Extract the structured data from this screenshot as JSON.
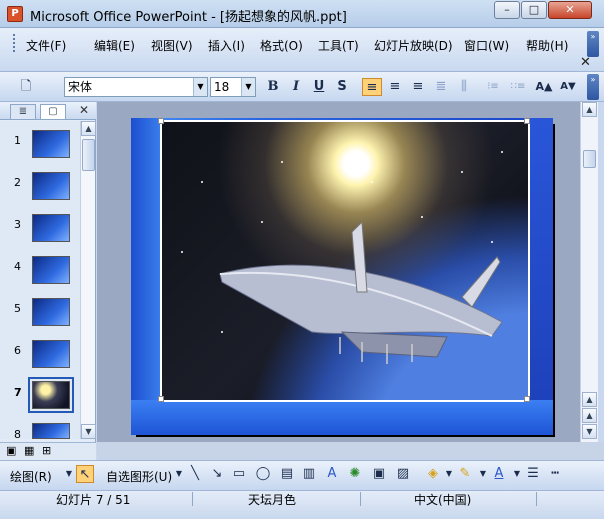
{
  "window": {
    "title": "Microsoft Office PowerPoint - [扬起想象的风帆.ppt]",
    "app_icon": "P",
    "min": "–",
    "max": "□",
    "close": "✕"
  },
  "menu": {
    "items": [
      "文件(F)",
      "编辑(E)",
      "视图(V)",
      "插入(I)",
      "格式(O)",
      "工具(T)",
      "幻灯片放映(D)",
      "窗口(W)",
      "帮助(H)"
    ],
    "close": "✕",
    "chevron": "»"
  },
  "toolbar": {
    "font_name": "宋体",
    "font_size": "18",
    "new_icon": "🗋",
    "bold": "B",
    "italic": "I",
    "underline": "U",
    "shadow": "S",
    "align_left": "≡",
    "align_center": "≡",
    "align_right": "≡",
    "justify": "≣",
    "columns": "⫼",
    "list_numbered": "⁝≡",
    "list_bullets": "∷≡",
    "grow_font": "A▲",
    "shrink_font": "A▼",
    "chevron": "»"
  },
  "panel": {
    "tab_outline": "≣",
    "tab_slides": "▢",
    "close": "✕",
    "slides": [
      {
        "num": "1",
        "style": "blue"
      },
      {
        "num": "2",
        "style": "blue"
      },
      {
        "num": "3",
        "style": "blue"
      },
      {
        "num": "4",
        "style": "blue"
      },
      {
        "num": "5",
        "style": "blue"
      },
      {
        "num": "6",
        "style": "blue"
      },
      {
        "num": "7",
        "style": "dark"
      },
      {
        "num": "8",
        "style": "blue"
      }
    ],
    "selected_slide": "7"
  },
  "drawing": {
    "draw_label": "绘图(R)",
    "autoshapes_label": "自选图形(U)"
  },
  "status": {
    "slide_info": "幻灯片 7 / 51",
    "template": "天坛月色",
    "language": "中文(中国)"
  }
}
